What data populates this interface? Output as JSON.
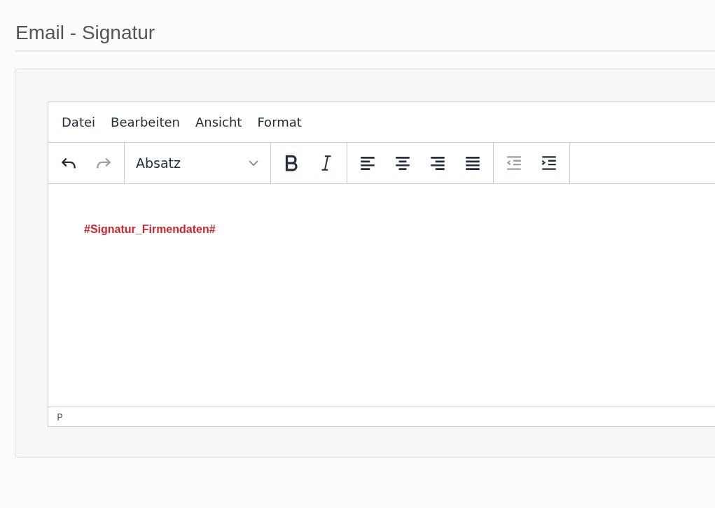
{
  "page_title": "Email - Signatur",
  "editor": {
    "menu": [
      {
        "label": "Datei"
      },
      {
        "label": "Bearbeiten"
      },
      {
        "label": "Ansicht"
      },
      {
        "label": "Format"
      }
    ],
    "toolbar": [
      [
        {
          "kind": "undo",
          "disabled": false
        },
        {
          "kind": "redo",
          "disabled": true
        }
      ],
      [
        {
          "kind": "select",
          "value": "Absatz"
        }
      ],
      [
        {
          "kind": "bold",
          "disabled": false
        },
        {
          "kind": "italic",
          "disabled": false
        }
      ],
      [
        {
          "kind": "align-left",
          "disabled": false
        },
        {
          "kind": "align-center",
          "disabled": false
        },
        {
          "kind": "align-right",
          "disabled": false
        },
        {
          "kind": "justify",
          "disabled": false
        }
      ],
      [
        {
          "kind": "outdent",
          "disabled": true
        },
        {
          "kind": "indent",
          "disabled": false
        }
      ]
    ],
    "content": "#Signatur_Firmendaten#",
    "status_path": "P"
  }
}
